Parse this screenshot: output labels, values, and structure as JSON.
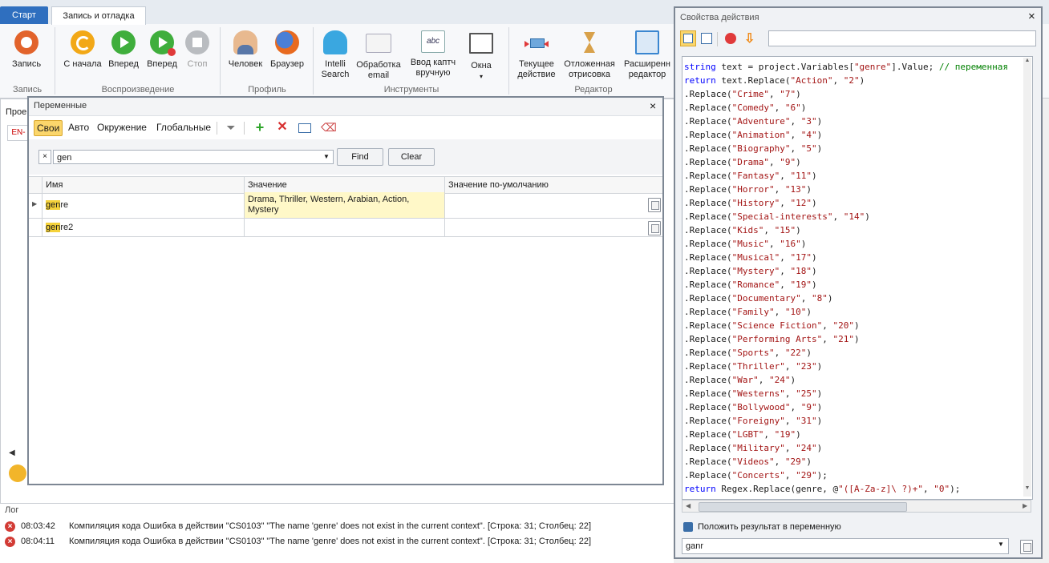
{
  "ribbon": {
    "tabs": [
      "Старт",
      "Запись и отладка"
    ],
    "buttons": {
      "record": "Запись",
      "from_start": "С начала",
      "forward": "Вперед",
      "forward2": "Вперед",
      "stop": "Стоп",
      "human": "Человек",
      "browser": "Браузер",
      "intelli_1": "Intelli",
      "intelli_2": "Search",
      "email_1": "Обработка",
      "email_2": "email",
      "captcha_1": "Ввод каптч",
      "captcha_2": "вручную",
      "windows": "Окна",
      "current_1": "Текущее",
      "current_2": "действие",
      "deferred_1": "Отложенная",
      "deferred_2": "отрисовка",
      "extended_1": "Расширенн",
      "extended_2": "редактор"
    },
    "groups": {
      "record": "Запись",
      "playback": "Воспроизведение",
      "profile": "Профиль",
      "tools": "Инструменты",
      "editor": "Редактор"
    }
  },
  "leftpanel": {
    "tab_label": "Прое",
    "lang": "EN-"
  },
  "variables": {
    "title": "Переменные",
    "tabs": [
      "Свои",
      "Авто",
      "Окружение",
      "Глобальные"
    ],
    "search_value": "gen",
    "find_label": "Find",
    "clear_label": "Clear",
    "columns": [
      "Имя",
      "Значение",
      "Значение по-умолчанию"
    ],
    "rows": [
      {
        "name_hl": "gen",
        "name_rest": "re",
        "value_1": "Drama, Thriller, Western, Arabian, Action,",
        "value_2": "Mystery",
        "default": ""
      },
      {
        "name_hl": "gen",
        "name_rest": "re2",
        "value_1": "",
        "value_2": "",
        "default": ""
      }
    ]
  },
  "properties": {
    "title": "Свойства действия",
    "save_label": "Положить результат в переменную",
    "result_var": "ganr",
    "code_lines": [
      {
        "a": "string",
        "b": " text = project.Variables[",
        "c": "\"genre\"",
        "d": "].Value; ",
        "e": "// переменная"
      },
      {
        "a": "return",
        "b": " text.Replace(",
        "c": "\"Action\"",
        "d": ", ",
        "e2": "\"2\"",
        "f": ")"
      }
    ],
    "replaces": [
      [
        "Crime",
        "7"
      ],
      [
        "Comedy",
        "6"
      ],
      [
        "Adventure",
        "3"
      ],
      [
        "Animation",
        "4"
      ],
      [
        "Biography",
        "5"
      ],
      [
        "Drama",
        "9"
      ],
      [
        "Fantasy",
        "11"
      ],
      [
        "Horror",
        "13"
      ],
      [
        "History",
        "12"
      ],
      [
        "Special-interests",
        "14"
      ],
      [
        "Kids",
        "15"
      ],
      [
        "Music",
        "16"
      ],
      [
        "Musical",
        "17"
      ],
      [
        "Mystery",
        "18"
      ],
      [
        "Romance",
        "19"
      ],
      [
        "Documentary",
        "8"
      ],
      [
        "Family",
        "10"
      ],
      [
        "Science Fiction",
        "20"
      ],
      [
        "Performing Arts",
        "21"
      ],
      [
        "Sports",
        "22"
      ],
      [
        "Thriller",
        "23"
      ],
      [
        "War",
        "24"
      ],
      [
        "Westerns",
        "25"
      ],
      [
        "Bollywood",
        "9"
      ],
      [
        "Foreigny",
        "31"
      ],
      [
        "LGBT",
        "19"
      ],
      [
        "Military",
        "24"
      ],
      [
        "Videos",
        "29"
      ],
      [
        "Concerts",
        "29"
      ]
    ],
    "last_line": {
      "kw": "return",
      "b": " Regex.Replace(genre, @",
      "c": "\"([A-Za-z]\\ ?)+\"",
      "d": ", ",
      "e": "\"0\"",
      "f": ");"
    }
  },
  "log": {
    "title": "Лог",
    "entries": [
      {
        "time": "08:03:42",
        "text": "Компиляция кода  Ошибка в действии \"CS0103\" \"The name 'genre' does not exist in the current context\". [Строка: 31; Столбец: 22]"
      },
      {
        "time": "08:04:11",
        "text": "Компиляция кода  Ошибка в действии \"CS0103\" \"The name 'genre' does not exist in the current context\". [Строка: 31; Столбец: 22]"
      }
    ]
  }
}
